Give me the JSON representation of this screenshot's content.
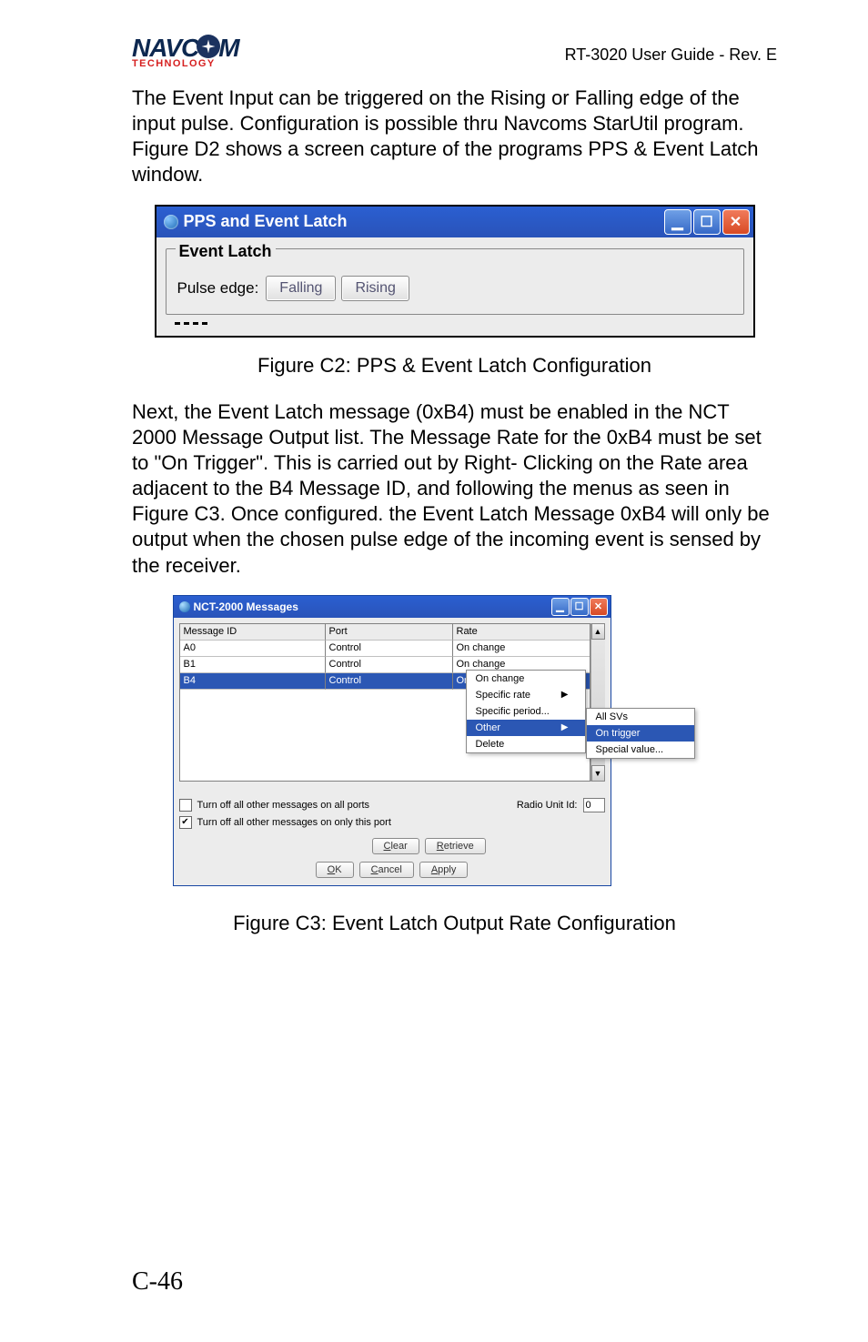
{
  "header": {
    "logo_main_left": "NAVC",
    "logo_main_right": "M",
    "logo_sub": "TECHNOLOGY",
    "doc_id": "RT-3020 User Guide - Rev. E"
  },
  "para1": "The Event Input can be triggered on the Rising  or Falling edge of the input pulse.  Configuration is possible thru Navcoms StarUtil program.  Figure D2 shows a screen capture of the programs PPS & Event Latch window.",
  "shot1": {
    "title": "PPS and Event Latch",
    "group_title": "Event Latch",
    "pulse_edge_label": "Pulse edge:",
    "btn_falling": "Falling",
    "btn_rising": "Rising"
  },
  "caption1": "Figure C2: PPS & Event Latch Configuration",
  "para2": "Next, the Event Latch message (0xB4) must be enabled in the NCT 2000 Message Output list. The Message Rate for the 0xB4 must be set to \"On Trigger\". This is carried out by Right- Clicking on the Rate area adjacent to the B4 Message ID, and following the menus as seen in Figure C3. Once configured. the Event Latch Message 0xB4 will only be output when the chosen pulse edge of the incoming event is sensed by the receiver.",
  "shot2": {
    "title": "NCT-2000 Messages",
    "columns": {
      "c1": "Message ID",
      "c2": "Port",
      "c3": "Rate"
    },
    "rows": [
      {
        "c1": "A0",
        "c2": "Control",
        "c3": "On change"
      },
      {
        "c1": "B1",
        "c2": "Control",
        "c3": "On change"
      },
      {
        "c1": "B4",
        "c2": "Control",
        "c3": "On change",
        "selected": true
      }
    ],
    "menu1": {
      "i1": "On change",
      "i2": "Specific rate",
      "i3": "Specific period...",
      "i4": "Other",
      "i5": "Delete"
    },
    "menu2": {
      "i1": "All SVs",
      "i2": "On trigger",
      "i3": "Special value..."
    },
    "chk1_label": "Turn off all other messages on all ports",
    "chk2_label": "Turn off all other messages on only this port",
    "radio_label": "Radio Unit Id:",
    "radio_value": "0",
    "btn_clear": "Clear",
    "btn_retrieve": "Retrieve",
    "btn_ok": "OK",
    "btn_cancel": "Cancel",
    "btn_apply": "Apply"
  },
  "caption2": "Figure C3: Event Latch Output Rate Configuration",
  "page_number": "C-46"
}
